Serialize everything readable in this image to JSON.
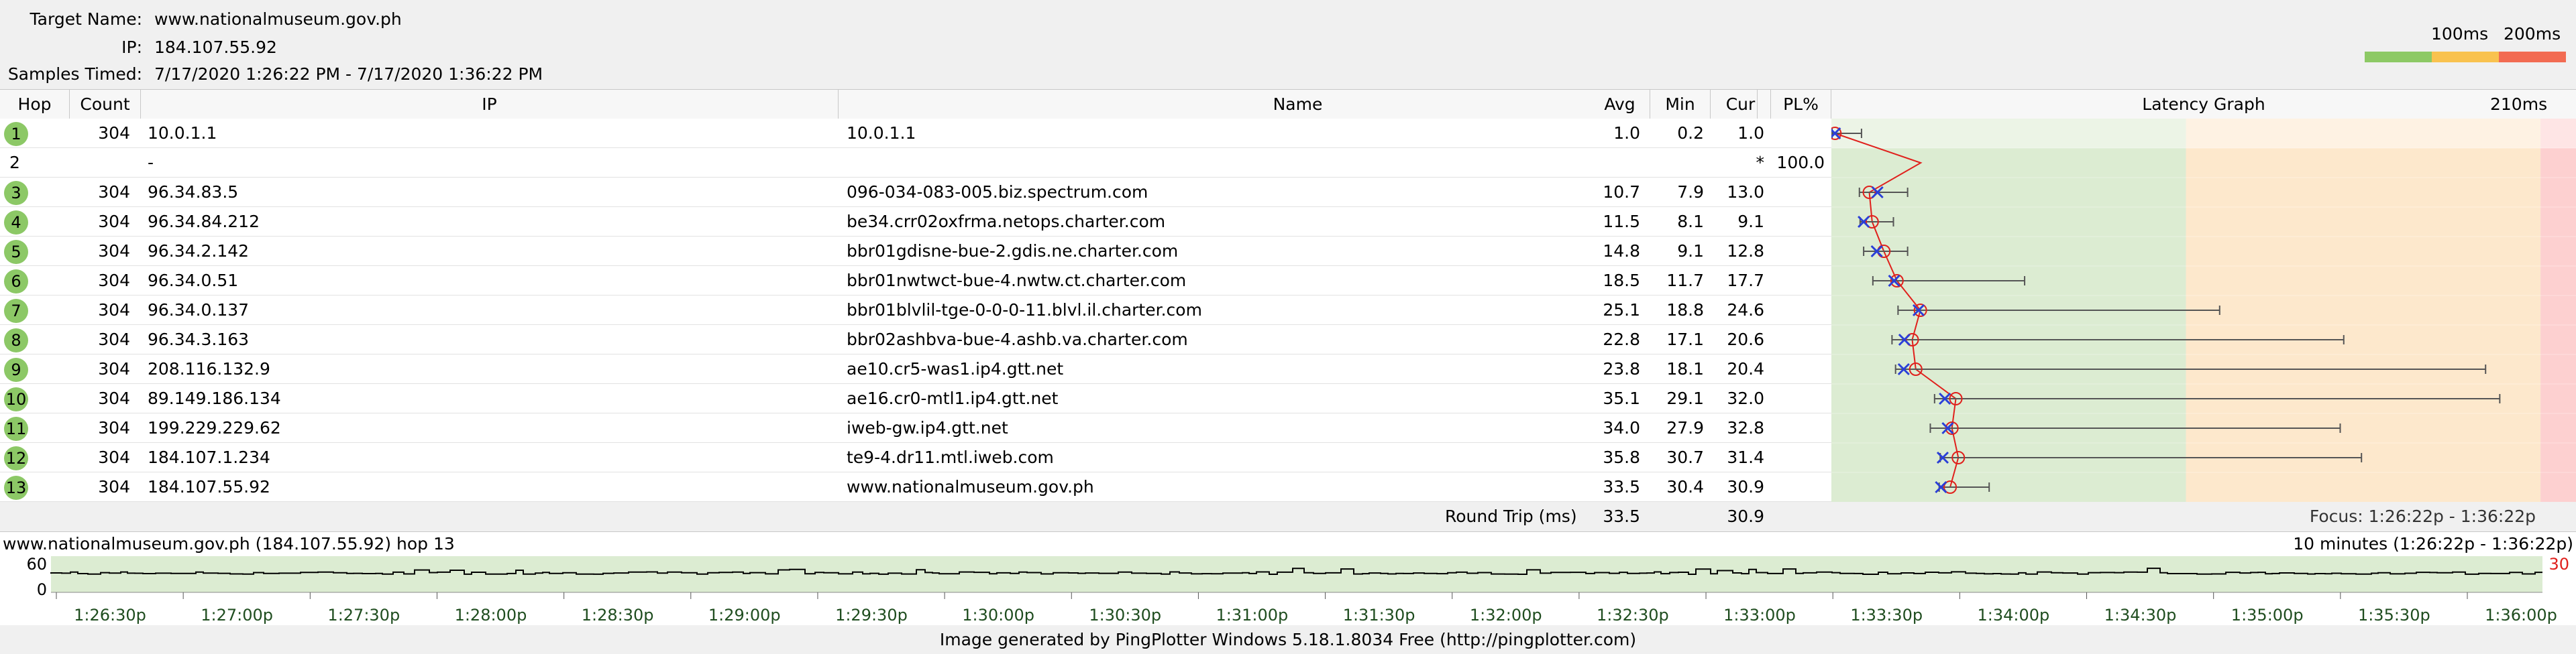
{
  "header": {
    "target_label": "Target Name:",
    "target_value": "www.nationalmuseum.gov.ph",
    "ip_label": "IP:",
    "ip_value": "184.107.55.92",
    "samples_label": "Samples Timed:",
    "samples_value": "7/17/2020 1:26:22 PM - 7/17/2020 1:36:22 PM",
    "scale_100": "100ms",
    "scale_200": "200ms",
    "scale_colors": [
      "#8dc965",
      "#f9c24f",
      "#f26b52"
    ]
  },
  "columns": {
    "hop": "Hop",
    "count": "Count",
    "ip": "IP",
    "name": "Name",
    "avg": "Avg",
    "min": "Min",
    "cur": "Cur",
    "pl": "PL%",
    "graph": "Latency Graph",
    "graph_max": "210ms"
  },
  "hops": [
    {
      "hop": "1",
      "count": "304",
      "ip": "10.0.1.1",
      "name": "10.0.1.1",
      "avg": "1.0",
      "min": "0.2",
      "cur": "1.0",
      "pl": "",
      "lat": {
        "avg": 1.0,
        "min": 0.2,
        "cur": 1.0,
        "max": 8.5
      }
    },
    {
      "hop": "2",
      "count": "",
      "ip": "-",
      "name": "",
      "avg": "",
      "min": "",
      "cur": "*",
      "pl": "100.0",
      "lat": null
    },
    {
      "hop": "3",
      "count": "304",
      "ip": "96.34.83.5",
      "name": "096-034-083-005.biz.spectrum.com",
      "avg": "10.7",
      "min": "7.9",
      "cur": "13.0",
      "pl": "",
      "lat": {
        "avg": 10.7,
        "min": 7.9,
        "cur": 13.0,
        "max": 21.5
      }
    },
    {
      "hop": "4",
      "count": "304",
      "ip": "96.34.84.212",
      "name": "be34.crr02oxfrma.netops.charter.com",
      "avg": "11.5",
      "min": "8.1",
      "cur": "9.1",
      "pl": "",
      "lat": {
        "avg": 11.5,
        "min": 8.1,
        "cur": 9.1,
        "max": 17.5
      }
    },
    {
      "hop": "5",
      "count": "304",
      "ip": "96.34.2.142",
      "name": "bbr01gdisne-bue-2.gdis.ne.charter.com",
      "avg": "14.8",
      "min": "9.1",
      "cur": "12.8",
      "pl": "",
      "lat": {
        "avg": 14.8,
        "min": 9.1,
        "cur": 12.8,
        "max": 21.5
      }
    },
    {
      "hop": "6",
      "count": "304",
      "ip": "96.34.0.51",
      "name": "bbr01nwtwct-bue-4.nwtw.ct.charter.com",
      "avg": "18.5",
      "min": "11.7",
      "cur": "17.7",
      "pl": "",
      "lat": {
        "avg": 18.5,
        "min": 11.7,
        "cur": 17.7,
        "max": 54.5
      }
    },
    {
      "hop": "7",
      "count": "304",
      "ip": "96.34.0.137",
      "name": "bbr01blvlil-tge-0-0-0-11.blvl.il.charter.com",
      "avg": "25.1",
      "min": "18.8",
      "cur": "24.6",
      "pl": "",
      "lat": {
        "avg": 25.1,
        "min": 18.8,
        "cur": 24.6,
        "max": 109.5
      }
    },
    {
      "hop": "8",
      "count": "304",
      "ip": "96.34.3.163",
      "name": "bbr02ashbva-bue-4.ashb.va.charter.com",
      "avg": "22.8",
      "min": "17.1",
      "cur": "20.6",
      "pl": "",
      "lat": {
        "avg": 22.8,
        "min": 17.1,
        "cur": 20.6,
        "max": 144.5
      }
    },
    {
      "hop": "9",
      "count": "304",
      "ip": "208.116.132.9",
      "name": "ae10.cr5-was1.ip4.gtt.net",
      "avg": "23.8",
      "min": "18.1",
      "cur": "20.4",
      "pl": "",
      "lat": {
        "avg": 23.8,
        "min": 18.1,
        "cur": 20.4,
        "max": 184.5
      }
    },
    {
      "hop": "10",
      "count": "304",
      "ip": "89.149.186.134",
      "name": "ae16.cr0-mtl1.ip4.gtt.net",
      "avg": "35.1",
      "min": "29.1",
      "cur": "32.0",
      "pl": "",
      "lat": {
        "avg": 35.1,
        "min": 29.1,
        "cur": 32.0,
        "max": 188.5
      }
    },
    {
      "hop": "11",
      "count": "304",
      "ip": "199.229.229.62",
      "name": "iweb-gw.ip4.gtt.net",
      "avg": "34.0",
      "min": "27.9",
      "cur": "32.8",
      "pl": "",
      "lat": {
        "avg": 34.0,
        "min": 27.9,
        "cur": 32.8,
        "max": 143.5
      }
    },
    {
      "hop": "12",
      "count": "304",
      "ip": "184.107.1.234",
      "name": "te9-4.dr11.mtl.iweb.com",
      "avg": "35.8",
      "min": "30.7",
      "cur": "31.4",
      "pl": "",
      "lat": {
        "avg": 35.8,
        "min": 30.7,
        "cur": 31.4,
        "max": 149.5
      }
    },
    {
      "hop": "13",
      "count": "304",
      "ip": "184.107.55.92",
      "name": "www.nationalmuseum.gov.ph",
      "avg": "33.5",
      "min": "30.4",
      "cur": "30.9",
      "pl": "",
      "lat": {
        "avg": 33.5,
        "min": 30.4,
        "cur": 30.9,
        "max": 44.5
      }
    }
  ],
  "footer_row": {
    "label": "Round Trip (ms)",
    "avg": "33.5",
    "cur": "30.9",
    "focus": "Focus: 1:26:22p - 1:36:22p"
  },
  "timeline": {
    "title": "www.nationalmuseum.gov.ph (184.107.55.92) hop 13",
    "range": "10 minutes (1:26:22p - 1:36:22p)",
    "y_top": "60",
    "y_bottom": "0",
    "right_marker": "30",
    "ticks": [
      "1:26:30p",
      "1:27:00p",
      "1:27:30p",
      "1:28:00p",
      "1:28:30p",
      "1:29:00p",
      "1:29:30p",
      "1:30:00p",
      "1:30:30p",
      "1:31:00p",
      "1:31:30p",
      "1:32:00p",
      "1:32:30p",
      "1:33:00p",
      "1:33:30p",
      "1:34:00p",
      "1:34:30p",
      "1:35:00p",
      "1:35:30p",
      "1:36:00p"
    ]
  },
  "chart_data": {
    "type": "line",
    "title": "Latency Graph",
    "xlim": [
      0,
      210
    ],
    "zones": [
      {
        "to": 100,
        "color": "#dcecd2"
      },
      {
        "to": 200,
        "color": "#fde8cc"
      },
      {
        "to": 210,
        "color": "#fdd0d0"
      }
    ]
  },
  "generated_by": "Image generated by PingPlotter Windows 5.18.1.8034 Free (http://pingplotter.com)"
}
